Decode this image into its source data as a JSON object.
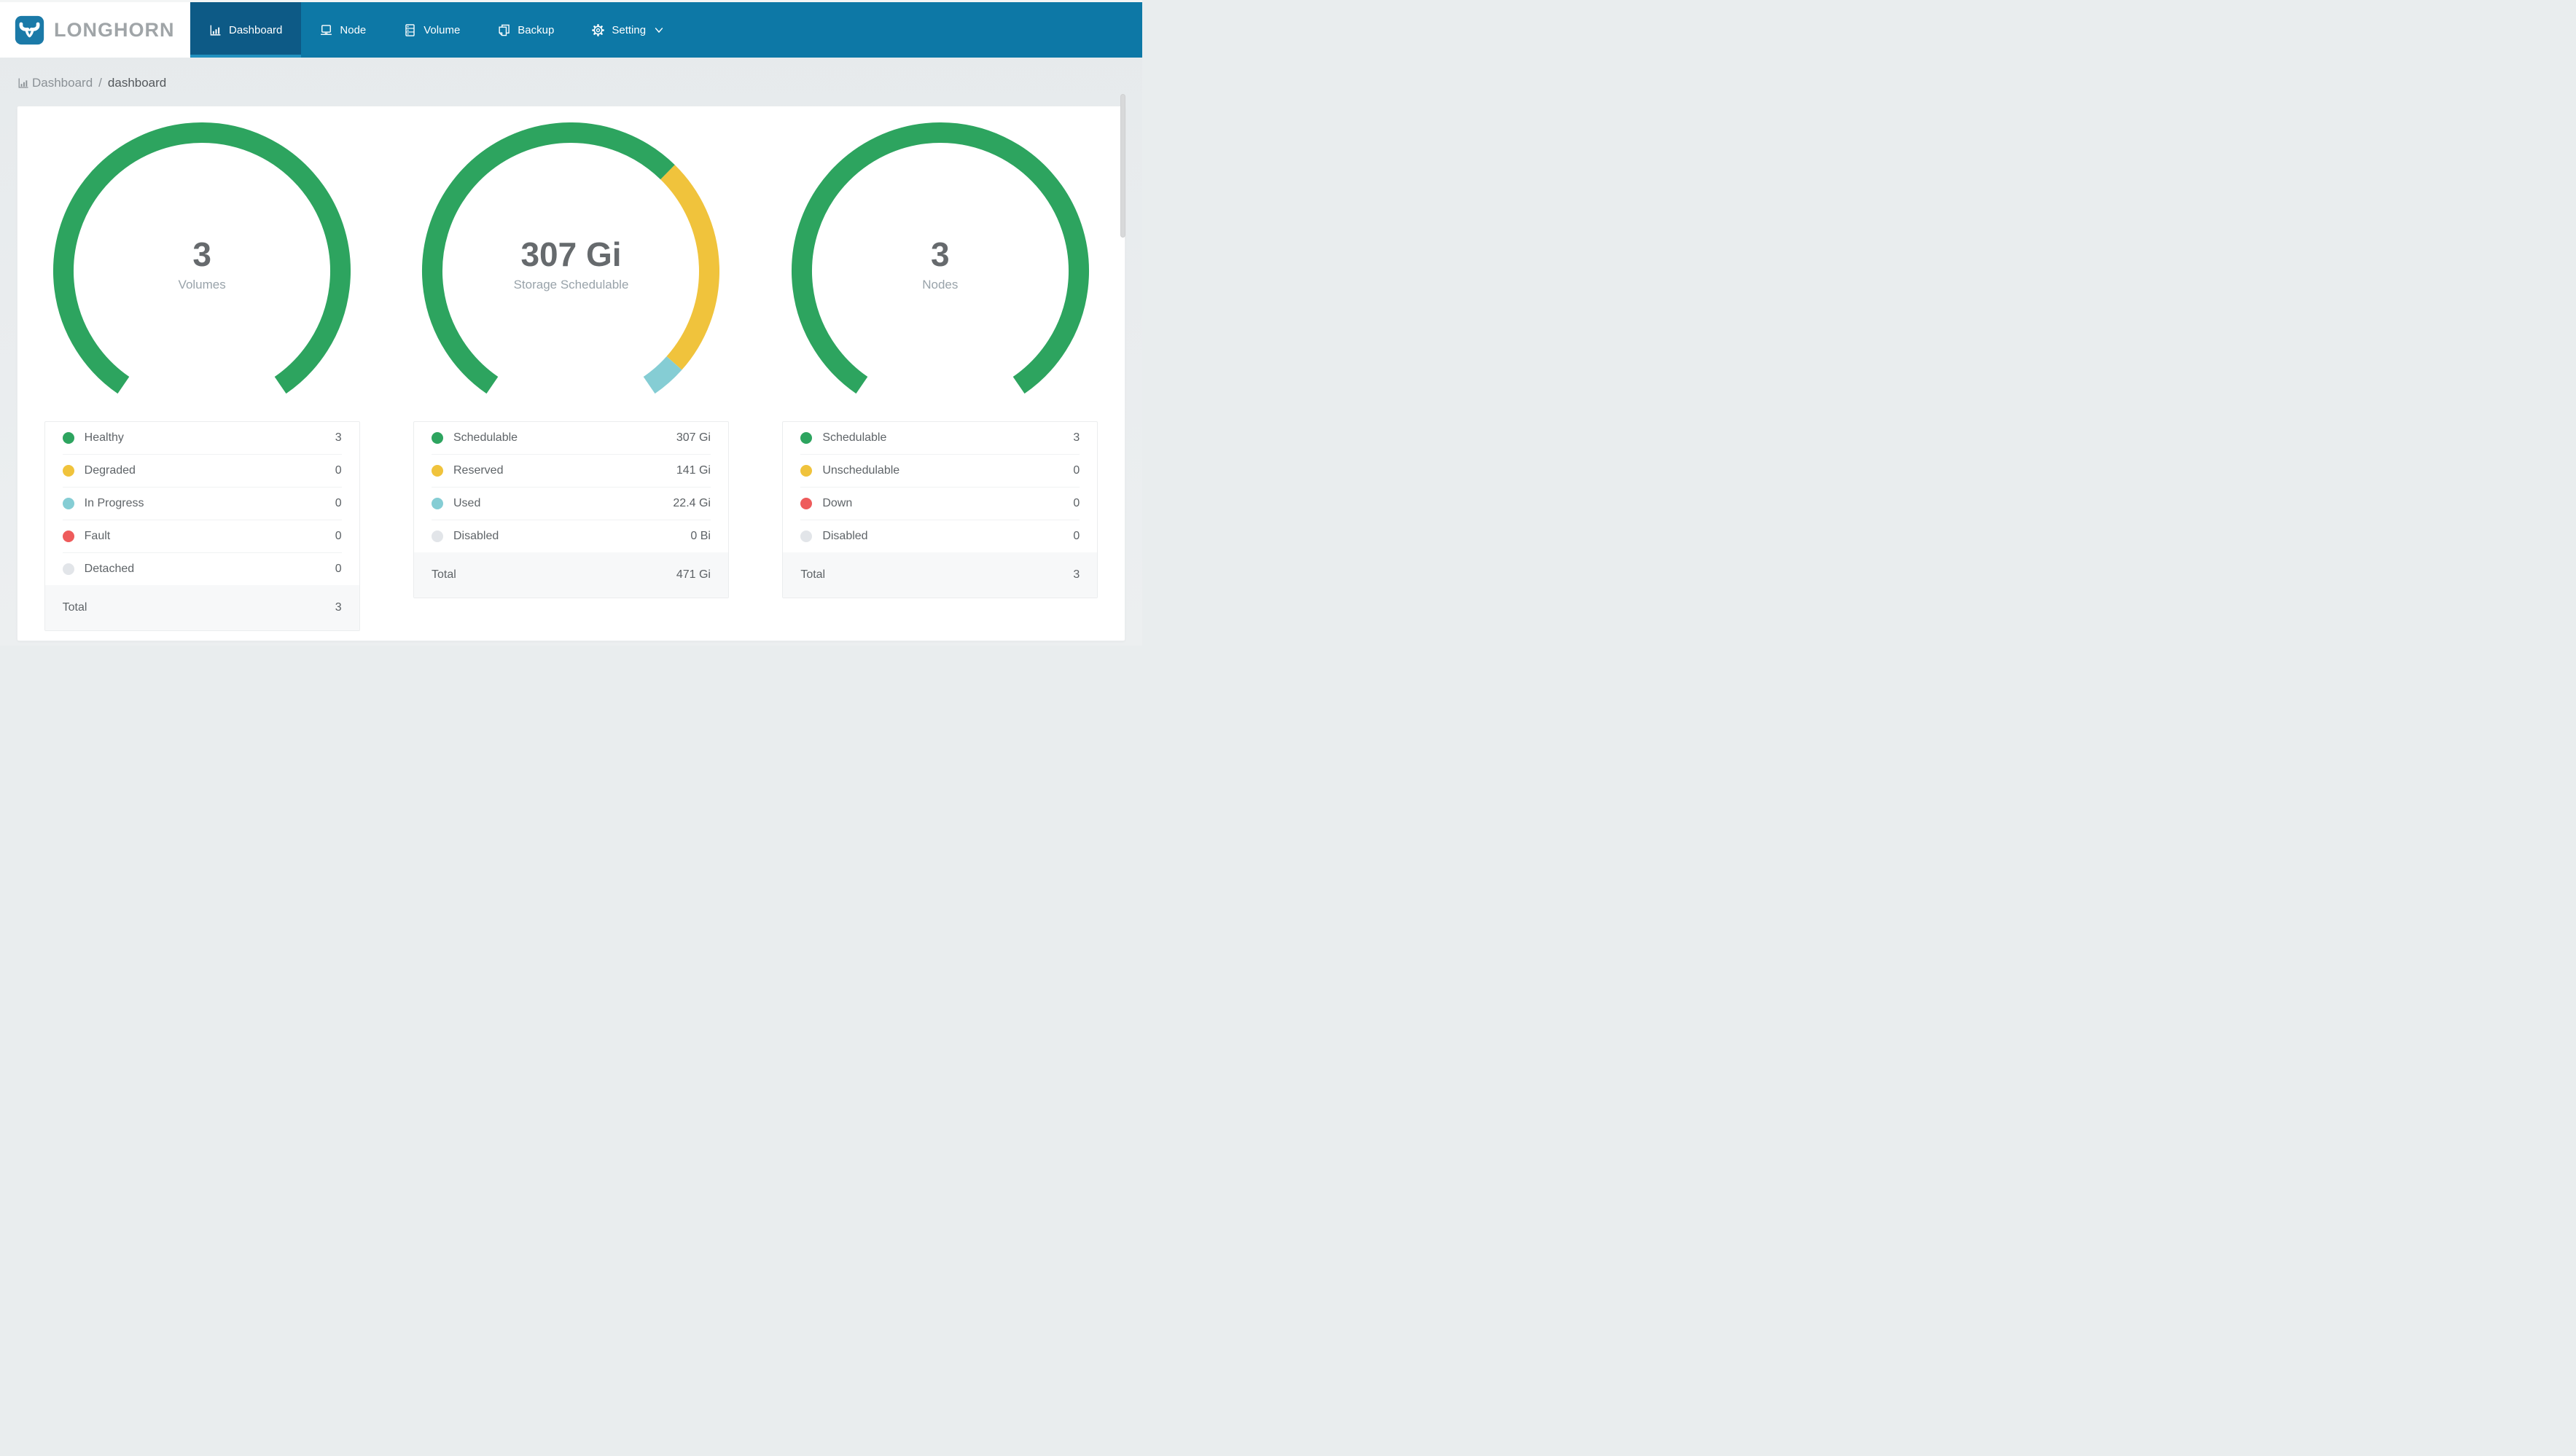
{
  "brand": {
    "name": "LONGHORN"
  },
  "nav": {
    "items": [
      {
        "id": "dashboard",
        "label": "Dashboard",
        "icon": "bar-chart",
        "active": true,
        "dropdown": false
      },
      {
        "id": "node",
        "label": "Node",
        "icon": "node",
        "active": false,
        "dropdown": false
      },
      {
        "id": "volume",
        "label": "Volume",
        "icon": "volume",
        "active": false,
        "dropdown": false
      },
      {
        "id": "backup",
        "label": "Backup",
        "icon": "backup",
        "active": false,
        "dropdown": false
      },
      {
        "id": "setting",
        "label": "Setting",
        "icon": "gear",
        "active": false,
        "dropdown": true
      }
    ]
  },
  "breadcrumb": {
    "section": "Dashboard",
    "separator": "/",
    "page": "dashboard"
  },
  "colors": {
    "nav_bg": "#0d78a6",
    "nav_active_bg": "#0d5a86",
    "nav_active_strip": "#2191bf",
    "logo_blue": "#1b7aa8",
    "page_bg": "#e9edee",
    "green": "#2da45f",
    "yellow": "#f0c33c",
    "teal": "#85cdd4",
    "red": "#ee5b5b",
    "gray": "#e2e5e9"
  },
  "dashboard": {
    "gauge": {
      "type": "gauge-donut",
      "start_angle": 214.5,
      "sweep": 291
    },
    "cards": [
      {
        "id": "volumes",
        "center_value": "3",
        "center_label": "Volumes",
        "rows": [
          {
            "label": "Healthy",
            "display": "3",
            "amount": 3,
            "color": "#2da45f"
          },
          {
            "label": "Degraded",
            "display": "0",
            "amount": 0,
            "color": "#f0c33c"
          },
          {
            "label": "In Progress",
            "display": "0",
            "amount": 0,
            "color": "#85cdd4"
          },
          {
            "label": "Fault",
            "display": "0",
            "amount": 0,
            "color": "#ee5b5b"
          },
          {
            "label": "Detached",
            "display": "0",
            "amount": 0,
            "color": "#e2e5e9"
          }
        ],
        "total_label": "Total",
        "total_display": "3"
      },
      {
        "id": "storage",
        "center_value": "307 Gi",
        "center_label": "Storage Schedulable",
        "rows": [
          {
            "label": "Schedulable",
            "display": "307 Gi",
            "amount": 307,
            "color": "#2da45f"
          },
          {
            "label": "Reserved",
            "display": "141 Gi",
            "amount": 141,
            "color": "#f0c33c"
          },
          {
            "label": "Used",
            "display": "22.4 Gi",
            "amount": 22.4,
            "color": "#85cdd4"
          },
          {
            "label": "Disabled",
            "display": "0 Bi",
            "amount": 0,
            "color": "#e2e5e9"
          }
        ],
        "total_label": "Total",
        "total_display": "471 Gi"
      },
      {
        "id": "nodes",
        "center_value": "3",
        "center_label": "Nodes",
        "rows": [
          {
            "label": "Schedulable",
            "display": "3",
            "amount": 3,
            "color": "#2da45f"
          },
          {
            "label": "Unschedulable",
            "display": "0",
            "amount": 0,
            "color": "#f0c33c"
          },
          {
            "label": "Down",
            "display": "0",
            "amount": 0,
            "color": "#ee5b5b"
          },
          {
            "label": "Disabled",
            "display": "0",
            "amount": 0,
            "color": "#e2e5e9"
          }
        ],
        "total_label": "Total",
        "total_display": "3"
      }
    ]
  }
}
